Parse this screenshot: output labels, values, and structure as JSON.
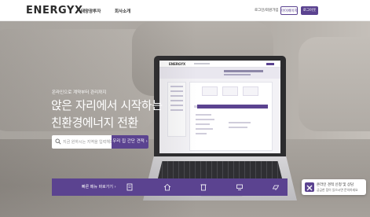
{
  "nav": {
    "logo": "ENERGYX",
    "links": [
      "태양광투자",
      "회사소개"
    ],
    "login_label": "로그인/회원가입",
    "outline_label": "마이페이지",
    "fill_label": "로그아웃"
  },
  "hero": {
    "eyebrow": "온라인으로 계약부터 관리까지",
    "headline_line1": "앉은 자리에서 시작하는",
    "headline_line2": "친환경에너지 전환",
    "search_placeholder": "지금 원하시는 지역을 입력해보세요",
    "cta_label": "우리 집 간단 견적 ›"
  },
  "laptop_screen": {
    "logo": "ENERGYX"
  },
  "quick_bar": {
    "label": "빠른 메뉴 바로가기 ›",
    "icons": [
      "document-icon",
      "house-icon",
      "building-icon",
      "monitor-icon",
      "panel-icon"
    ]
  },
  "chat": {
    "title": "온라인 견적 신청 및 상담",
    "subtitle": "궁금한 점이 있으시면 문의하세요"
  },
  "colors": {
    "brand": "#5b4390",
    "nav_bg": "#ffffff"
  }
}
